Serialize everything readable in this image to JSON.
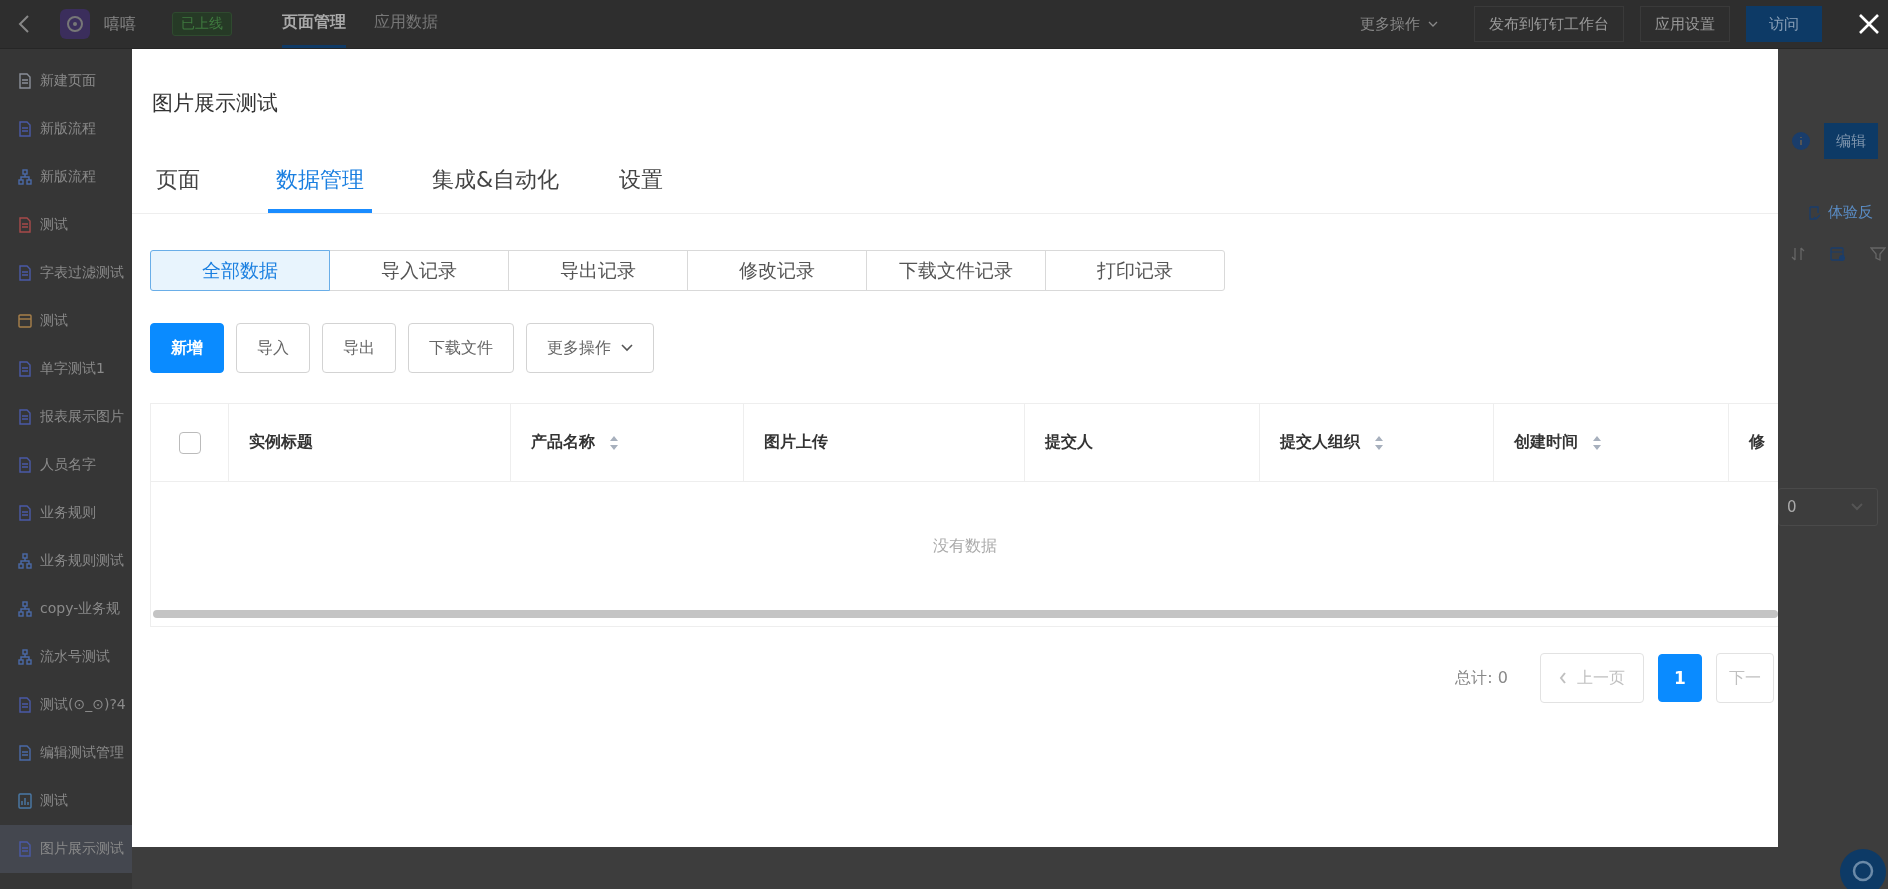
{
  "topbar": {
    "app_name": "嘻嘻",
    "status_tag": "已上线",
    "nav": [
      {
        "label": "页面管理",
        "selected": true
      },
      {
        "label": "应用数据",
        "selected": false
      }
    ],
    "more_menu": "更多操作",
    "buttons": [
      {
        "label": "发布到钉钉工作台",
        "kind": "default"
      },
      {
        "label": "应用设置",
        "kind": "default"
      },
      {
        "label": "访问",
        "kind": "primary"
      }
    ]
  },
  "sidebar": {
    "items": [
      {
        "label": "新建页面",
        "kind": "new",
        "selected": false
      },
      {
        "label": "新版流程",
        "kind": "doc",
        "selected": false
      },
      {
        "label": "新版流程",
        "kind": "flow",
        "selected": false
      },
      {
        "label": "测试",
        "kind": "report",
        "selected": false
      },
      {
        "label": "字表过滤测试",
        "kind": "doc",
        "selected": false
      },
      {
        "label": "测试",
        "kind": "window",
        "selected": false
      },
      {
        "label": "单字测试1",
        "kind": "doc",
        "selected": false
      },
      {
        "label": "报表展示图片",
        "kind": "doc",
        "selected": false
      },
      {
        "label": "人员名字",
        "kind": "doc",
        "selected": false
      },
      {
        "label": "业务规则",
        "kind": "doc",
        "selected": false
      },
      {
        "label": "业务规则测试",
        "kind": "flow",
        "selected": false
      },
      {
        "label": "copy-业务规",
        "kind": "flow",
        "selected": false
      },
      {
        "label": "流水号测试",
        "kind": "flow",
        "selected": false
      },
      {
        "label": "测试(⊙_⊙)?4",
        "kind": "doc",
        "selected": false
      },
      {
        "label": "编辑测试管理",
        "kind": "user",
        "selected": false
      },
      {
        "label": "测试",
        "kind": "chart",
        "selected": false
      },
      {
        "label": "图片展示测试",
        "kind": "doc",
        "selected": true
      }
    ]
  },
  "right_panel": {
    "edit_button": "编辑",
    "feedback_link": "体验反",
    "select_value": "0"
  },
  "modal": {
    "title": "图片展示测试",
    "tabs": [
      {
        "label": "页面",
        "selected": false
      },
      {
        "label": "数据管理",
        "selected": true
      },
      {
        "label": "集成&自动化",
        "selected": false
      },
      {
        "label": "设置",
        "selected": false
      }
    ],
    "record_tabs": [
      {
        "label": "全部数据",
        "selected": true
      },
      {
        "label": "导入记录",
        "selected": false
      },
      {
        "label": "导出记录",
        "selected": false
      },
      {
        "label": "修改记录",
        "selected": false
      },
      {
        "label": "下载文件记录",
        "selected": false
      },
      {
        "label": "打印记录",
        "selected": false
      }
    ],
    "actions": [
      {
        "label": "新增",
        "kind": "primary"
      },
      {
        "label": "导入",
        "kind": "default"
      },
      {
        "label": "导出",
        "kind": "default"
      },
      {
        "label": "下载文件",
        "kind": "default"
      },
      {
        "label": "更多操作",
        "kind": "dropdown"
      }
    ],
    "table": {
      "select_all": {
        "checked": false
      },
      "columns": [
        {
          "label": "实例标题",
          "sortable": false
        },
        {
          "label": "产品名称",
          "sortable": true
        },
        {
          "label": "图片上传",
          "sortable": false
        },
        {
          "label": "提交人",
          "sortable": false
        },
        {
          "label": "提交人组织",
          "sortable": true
        },
        {
          "label": "创建时间",
          "sortable": true
        },
        {
          "label": "修"
        }
      ],
      "empty_text": "没有数据"
    },
    "pagination": {
      "total": "总计: 0",
      "prev": {
        "label": "上一页",
        "disabled": true
      },
      "pages": [
        {
          "label": "1",
          "selected": true
        }
      ],
      "next": {
        "label": "下一",
        "disabled": true
      }
    }
  }
}
